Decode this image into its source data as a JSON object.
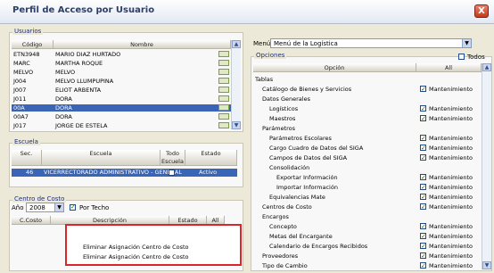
{
  "window": {
    "title": "Perfil de Acceso por Usuario",
    "close": "X"
  },
  "usuarios": {
    "legend": "Usuarios",
    "headers": {
      "codigo": "Código",
      "nombre": "Nombre"
    },
    "rows": [
      {
        "codigo": "ETN3948",
        "nombre": "MARIO DIAZ HURTADO"
      },
      {
        "codigo": "MARC",
        "nombre": "MARTHA ROQUE"
      },
      {
        "codigo": "MELVO",
        "nombre": "MELVO"
      },
      {
        "codigo": "J004",
        "nombre": "MELVO LLUMPUPINA"
      },
      {
        "codigo": "J007",
        "nombre": "ELIOT ARBENTA"
      },
      {
        "codigo": "J011",
        "nombre": "DORA"
      },
      {
        "codigo": "00A",
        "nombre": "DORA"
      },
      {
        "codigo": "00A7",
        "nombre": "DORA"
      },
      {
        "codigo": "J017",
        "nombre": "JORGE DE ESTELA"
      }
    ],
    "selected_index": 6
  },
  "escuela": {
    "legend": "Escuela",
    "headers": {
      "sec": "Sec.",
      "escuela": "Escuela",
      "todo": "Todo Escuela",
      "estado": "Estado"
    },
    "rows": [
      {
        "sec": "46",
        "escuela": "VICERRECTORADO ADMINISTRATIVO - GENERAL",
        "estado": "Activo"
      }
    ]
  },
  "centro_costo": {
    "legend": "Centro de Costo",
    "anio_label": "Año",
    "anio_value": "2008",
    "por_techo_label": "Por Techo",
    "headers": {
      "c": "C.Costo",
      "descripcion": "Descripción",
      "estado": "Estado",
      "all": "All"
    },
    "context_menu": [
      "Eliminar Asignación Centro de Costo",
      "Eliminar Asignación Centro de Costo"
    ]
  },
  "menu_label": "Menú",
  "menu_value": "Menú de la Logística",
  "opciones": {
    "legend": "Opciones",
    "todos_label": "Todos",
    "headers": {
      "opcion": "Opción",
      "all": "All"
    },
    "rows": [
      {
        "label": "Tablas",
        "indent": 0,
        "check": false,
        "value": ""
      },
      {
        "label": "Catálogo de Bienes y Servicios",
        "indent": 1,
        "check": true,
        "value": "Mantenimiento"
      },
      {
        "label": "Datos Generales",
        "indent": 1,
        "check": false,
        "value": ""
      },
      {
        "label": "Logísticos",
        "indent": 2,
        "check": true,
        "value": "Mantenimiento"
      },
      {
        "label": "Maestros",
        "indent": 2,
        "check": true,
        "value": "Mantenimiento"
      },
      {
        "label": "Parámetros",
        "indent": 1,
        "check": false,
        "value": ""
      },
      {
        "label": "Parámetros Escolares",
        "indent": 2,
        "check": true,
        "value": "Mantenimiento"
      },
      {
        "label": "Cargo Cuadro de Datos del SIGA",
        "indent": 2,
        "check": true,
        "value": "Mantenimiento"
      },
      {
        "label": "Campos de Datos del SIGA",
        "indent": 2,
        "check": true,
        "value": "Mantenimiento"
      },
      {
        "label": "Consolidación",
        "indent": 2,
        "check": false,
        "value": ""
      },
      {
        "label": "Exportar Información",
        "indent": 3,
        "check": true,
        "value": "Mantenimiento"
      },
      {
        "label": "Importar Información",
        "indent": 3,
        "check": true,
        "value": "Mantenimiento"
      },
      {
        "label": "Equivalencias Mate",
        "indent": 2,
        "check": true,
        "value": "Mantenimiento"
      },
      {
        "label": "Centros de Costo",
        "indent": 1,
        "check": true,
        "value": "Mantenimiento"
      },
      {
        "label": "Encargos",
        "indent": 1,
        "check": false,
        "value": ""
      },
      {
        "label": "Concepto",
        "indent": 2,
        "check": true,
        "value": "Mantenimiento"
      },
      {
        "label": "Metas del Encargante",
        "indent": 2,
        "check": true,
        "value": "Mantenimiento"
      },
      {
        "label": "Calendario de Encargos Recibidos",
        "indent": 2,
        "check": true,
        "value": "Mantenimiento"
      },
      {
        "label": "Proveedores",
        "indent": 1,
        "check": true,
        "value": "Mantenimiento"
      },
      {
        "label": "Tipo de Cambio",
        "indent": 1,
        "check": true,
        "value": "Mantenimiento"
      }
    ]
  },
  "colors": {
    "selection": "#3a64b5",
    "legend_text": "#1e2f7a",
    "highlight_box": "#d8262a",
    "window_bg": "#ece9d8"
  },
  "icons": {
    "close": "close-icon",
    "dropdown": "chevron-down-icon",
    "scroll_up": "scroll-up-icon",
    "scroll_down": "scroll-down-icon"
  }
}
